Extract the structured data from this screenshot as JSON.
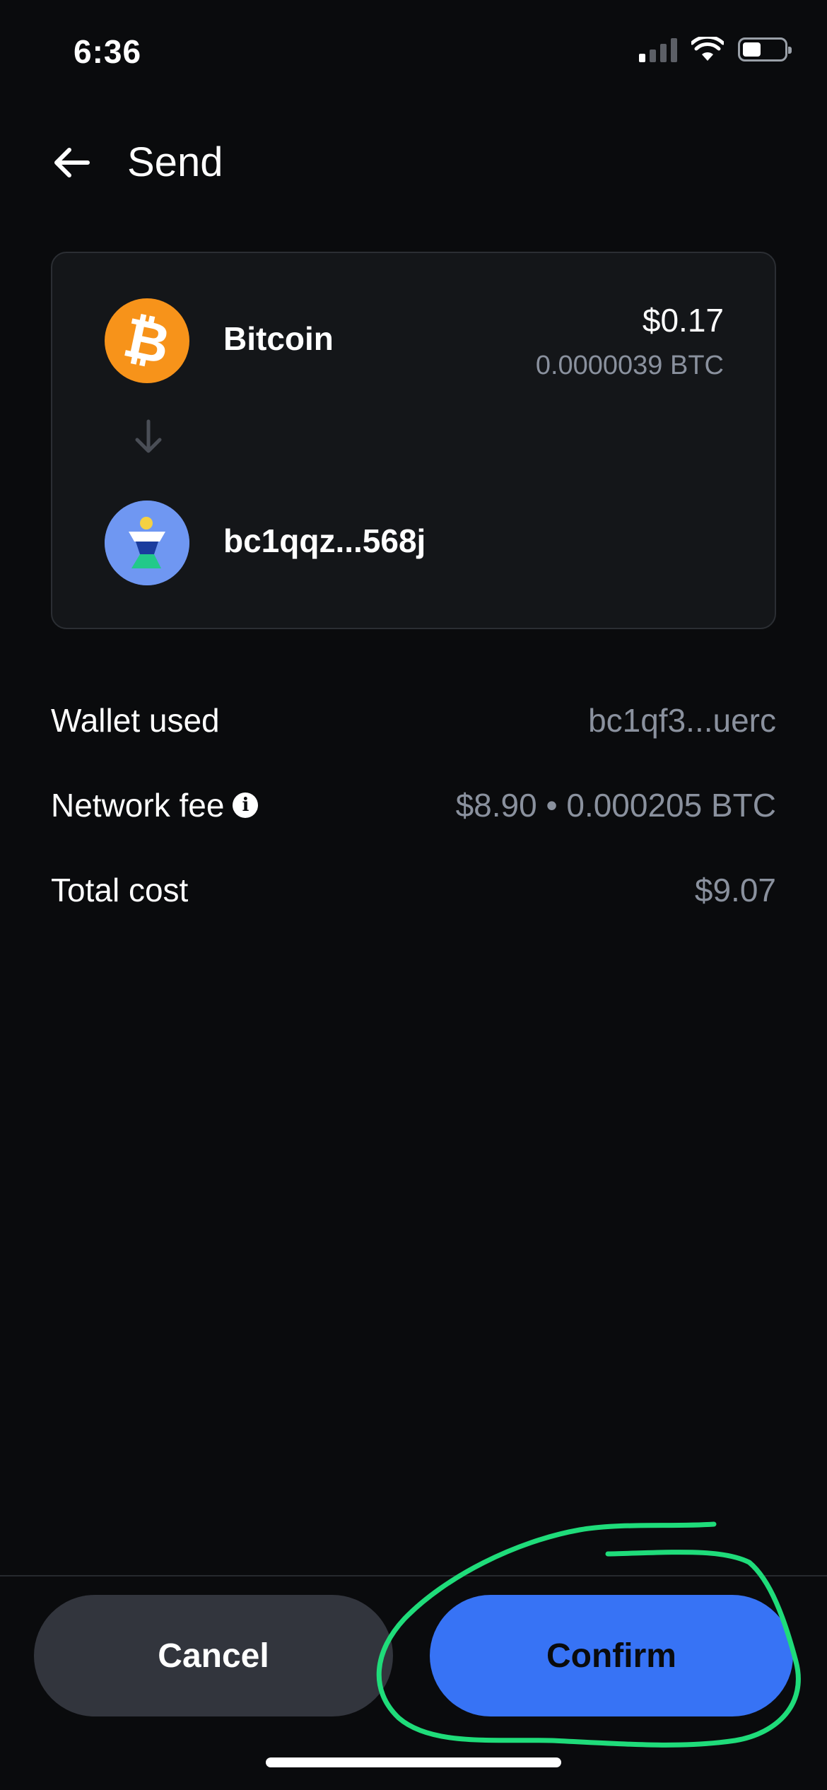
{
  "status_bar": {
    "time": "6:36"
  },
  "header": {
    "title": "Send"
  },
  "asset": {
    "name": "Bitcoin",
    "usd_amount": "$0.17",
    "btc_amount": "0.0000039 BTC",
    "icon": "bitcoin-icon",
    "color": "#f7931a"
  },
  "recipient": {
    "address": "bc1qqz...568j",
    "icon": "recipient-avatar-icon"
  },
  "details": {
    "wallet_used": {
      "label": "Wallet used",
      "value": "bc1qf3...uerc"
    },
    "network_fee": {
      "label": "Network fee",
      "value": "$8.90 • 0.000205 BTC"
    },
    "total_cost": {
      "label": "Total cost",
      "value": "$9.07"
    }
  },
  "actions": {
    "cancel_label": "Cancel",
    "confirm_label": "Confirm"
  },
  "colors": {
    "background": "#0a0b0d",
    "accent": "#3773f5",
    "annotation": "#1fdc7a"
  }
}
